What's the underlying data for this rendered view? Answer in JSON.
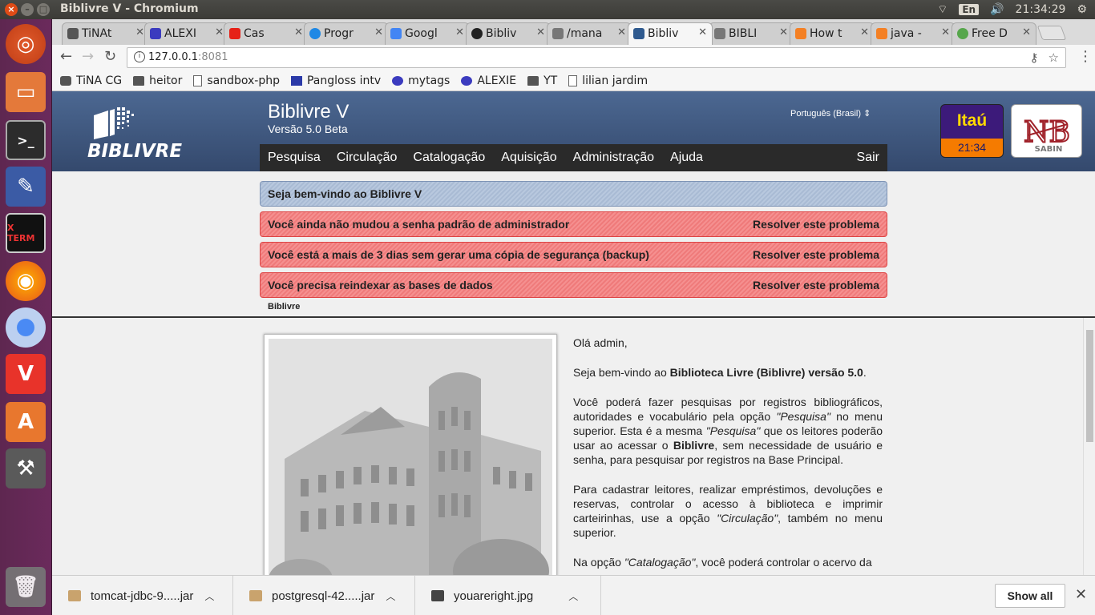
{
  "system": {
    "window_title": "Biblivre V - Chromium",
    "keyboard_lang": "En",
    "clock": "21:34:29"
  },
  "tabs": [
    {
      "label": "TiNAt",
      "icon_color": "#555555"
    },
    {
      "label": "ALEXI",
      "icon_color": "#3b3bbf"
    },
    {
      "label": "Cas",
      "icon_color": "#e62117"
    },
    {
      "label": "Progr",
      "icon_color": "#1e88e5"
    },
    {
      "label": "Googl",
      "icon_color": "#4285f4"
    },
    {
      "label": "Bibliv",
      "icon_color": "#222222"
    },
    {
      "label": "/mana",
      "icon_color": "#777777"
    },
    {
      "label": "Bibliv",
      "icon_color": "#2f5a8f"
    },
    {
      "label": "BIBLI",
      "icon_color": "#777777"
    },
    {
      "label": "How t",
      "icon_color": "#f48024"
    },
    {
      "label": "java -",
      "icon_color": "#f48024"
    },
    {
      "label": "Free D",
      "icon_color": "#56a64b"
    }
  ],
  "omnibox": {
    "host": "127.0.0.1",
    "port": ":8081"
  },
  "bookmarks": [
    {
      "label": "TiNA CG",
      "type": "site"
    },
    {
      "label": "heitor",
      "type": "folder"
    },
    {
      "label": "sandbox-php",
      "type": "page"
    },
    {
      "label": "Pangloss intv",
      "type": "site"
    },
    {
      "label": "mytags",
      "type": "site"
    },
    {
      "label": "ALEXIE",
      "type": "site"
    },
    {
      "label": "YT",
      "type": "folder"
    },
    {
      "label": "lilian jardim",
      "type": "page"
    }
  ],
  "app": {
    "logo_text": "BIBLIVRE",
    "title": "Biblivre V",
    "version": "Versão 5.0 Beta",
    "language": "Português (Brasil)",
    "menu": [
      "Pesquisa",
      "Circulação",
      "Catalogação",
      "Aquisição",
      "Administração",
      "Ajuda"
    ],
    "logout": "Sair",
    "itau_brand": "Itaú",
    "itau_time": "21:34",
    "sabin_text": "SABIN"
  },
  "notices": {
    "welcome": "Seja bem-vindo ao Biblivre V",
    "warnings": [
      {
        "text": "Você ainda não mudou a senha padrão de administrador",
        "action": "Resolver este problema"
      },
      {
        "text": "Você está a mais de 3 dias sem gerar uma cópia de segurança (backup)",
        "action": "Resolver este problema"
      },
      {
        "text": "Você precisa reindexar as bases de dados",
        "action": "Resolver este problema"
      }
    ]
  },
  "breadcrumb": "Biblivre",
  "content": {
    "greeting": "Olá admin,",
    "p1_prefix": "Seja bem-vindo ao ",
    "p1_bold": "Biblioteca Livre (Biblivre) versão 5.0",
    "p1_suffix": ".",
    "p2_a": "Você poderá fazer pesquisas por registros bibliográficos, autoridades e vocabulário pela opção ",
    "p2_em1": "\"Pesquisa\"",
    "p2_b": " no menu superior. Esta é a mesma ",
    "p2_em2": "\"Pesquisa\"",
    "p2_c": " que os leitores poderão usar ao acessar o ",
    "p2_bold": "Biblivre",
    "p2_d": ", sem necessidade de usuário e senha, para pesquisar por registros na Base Principal.",
    "p3_a": "Para cadastrar leitores, realizar empréstimos, devoluções e reservas, controlar o acesso à biblioteca e imprimir carteirinhas, use a opção ",
    "p3_em": "\"Circulação\"",
    "p3_b": ", também no menu superior.",
    "p4_a": "Na opção ",
    "p4_em": "\"Catalogação\"",
    "p4_b": ", você poderá controlar o acervo da"
  },
  "downloads": {
    "items": [
      {
        "name": "tomcat-jdbc-9.....jar",
        "type": "jar"
      },
      {
        "name": "postgresql-42.....jar",
        "type": "jar"
      },
      {
        "name": "youareright.jpg",
        "type": "img"
      }
    ],
    "show_all": "Show all"
  }
}
